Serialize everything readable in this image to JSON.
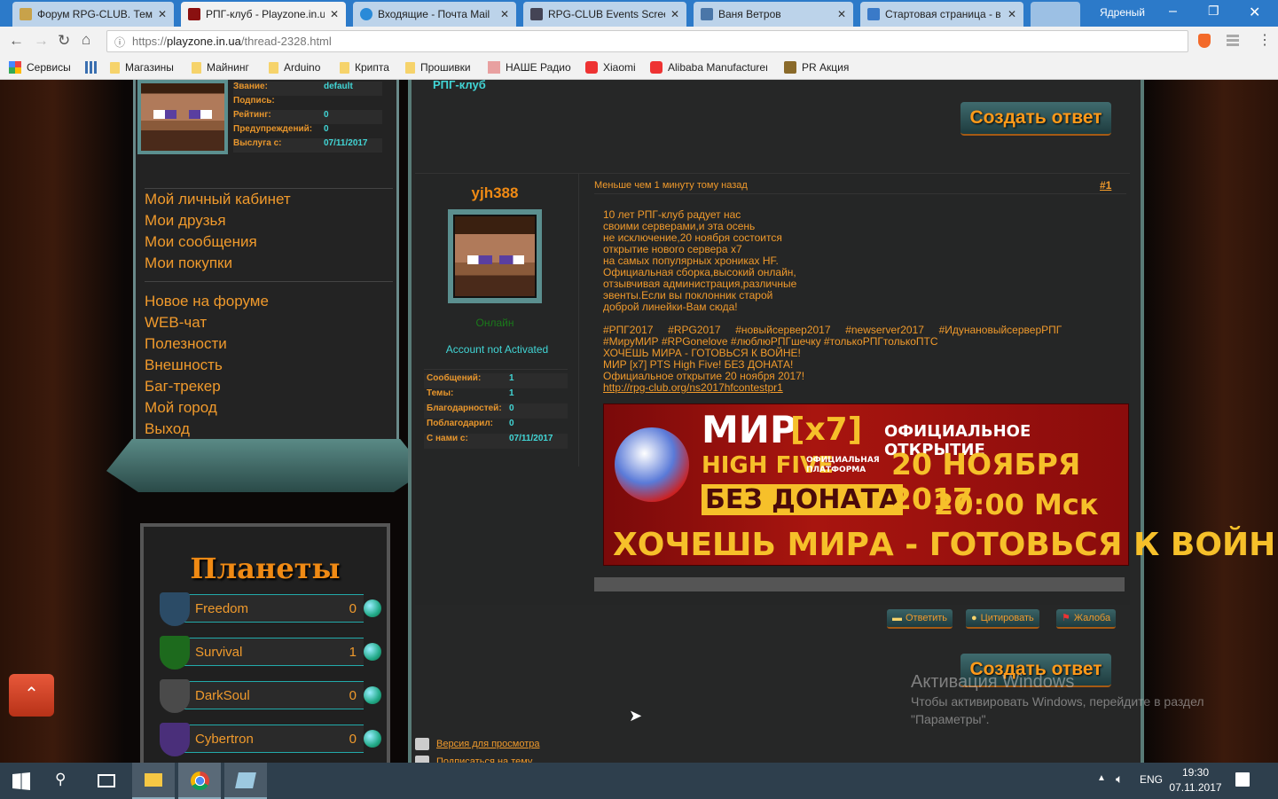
{
  "browser": {
    "tabs": [
      {
        "label": "Форум RPG-CLUB. Тема",
        "color": "#c8a24a"
      },
      {
        "label": "РПГ-клуб - Playzone.in.u",
        "color": "#8a1010",
        "active": true
      },
      {
        "label": "Входящие - Почта Mail",
        "color": "#2a8ad8"
      },
      {
        "label": "RPG-CLUB Events Screen",
        "color": "#445"
      },
      {
        "label": "Ваня Ветров",
        "color": "#4a76a8"
      },
      {
        "label": "Стартовая страница - в",
        "color": "#3a7ac8"
      }
    ],
    "profile_name": "Ядреный",
    "url_prefix": "https://",
    "url_host": "playzone.in.ua",
    "url_path": "/thread-2328.html",
    "bookmarks": [
      "Сервисы",
      "Магазины",
      "Майнинг",
      "Arduino",
      "Крипта",
      "Прошивки",
      "НАШЕ Радио",
      "Xiaomi",
      "Alibaba Manufacturer",
      "PR Акция"
    ]
  },
  "sidebar": {
    "stats": [
      {
        "label": "Звание:",
        "value": "default"
      },
      {
        "label": "Подпись:",
        "value": ""
      },
      {
        "label": "Рейтинг:",
        "value": "0"
      },
      {
        "label": "Предупреждений:",
        "value": "0"
      },
      {
        "label": "Выслуга с:",
        "value": "07/11/2017"
      }
    ],
    "menu1": [
      "Мой личный кабинет",
      "Мои друзья",
      "Мои сообщения",
      "Мои покупки"
    ],
    "menu2": [
      "Новое на форуме",
      "WEB-чат",
      "Полезности",
      "Внешность",
      "Баг-трекер",
      "Мой город",
      "Выход"
    ],
    "planets_title": "Планеты",
    "planets": [
      {
        "name": "Freedom",
        "count": "0",
        "color": "#2b4b66"
      },
      {
        "name": "Survival",
        "count": "1",
        "color": "#1d6a1d"
      },
      {
        "name": "DarkSoul",
        "count": "0",
        "color": "#4a4a4a"
      },
      {
        "name": "Cybertron",
        "count": "0",
        "color": "#4a2f7a"
      }
    ]
  },
  "main": {
    "forum_title": "РПГ-клуб",
    "create_reply": "Создать ответ",
    "post": {
      "author": "yjh388",
      "status": "Онлайн",
      "account": "Account not Activated",
      "stats": [
        {
          "label": "Сообщений:",
          "value": "1"
        },
        {
          "label": "Темы:",
          "value": "1"
        },
        {
          "label": "Благодарностей:",
          "value": "0"
        },
        {
          "label": "Поблагодарил:",
          "value": "0"
        },
        {
          "label": "С нами с:",
          "value": "07/11/2017"
        }
      ],
      "time": "Меньше чем 1 минуту тому назад",
      "number": "#1",
      "lines": [
        "10 лет РПГ-клуб радует нас",
        "своими серверами,и эта осень",
        "не исключение,20 ноября состоится",
        "открытие нового сервера x7",
        "на самых популярных хрониках HF.",
        "Официальная сборка,высокий онлайн,",
        "отзывчивая администрация,различные",
        "эвенты.Если вы поклонник старой",
        "доброй линейки-Вам сюда!"
      ],
      "hashtags1": "#РПГ2017     #RPG2017     #новыйсервер2017     #newserver2017     #ИдунановыйсерверРПГ",
      "lines2": [
        "#МируМИР #RPGonelove #люблюРПГшечку #толькоРПГтолькоПТС",
        "ХОЧЕШЬ МИРА - ГОТОВЬСЯ К ВОЙНЕ!",
        "МИР [x7] PTS High Five! БЕЗ ДОНАТА!",
        "Официальное открытие 20 ноября 2017!"
      ],
      "link": "http://rpg-club.org/ns2017hfcontestpr1",
      "banner": {
        "mir": "МИР",
        "x7": "[x7]",
        "hf": "HIGH FIVE",
        "platform": "ОФИЦИАЛЬНАЯ ПЛАТФОРМА",
        "nodonate": "БЕЗ ДОНАТА",
        "open": "ОФИЦИАЛЬНОЕ ОТКРЫТИЕ",
        "date": "20 НОЯБРЯ 2017",
        "time": "20:00 Мск",
        "slogan": "ХОЧЕШЬ МИРА - ГОТОВЬСЯ К ВОЙНЕ"
      },
      "actions": [
        "Ответить",
        "Цитировать",
        "Жалоба"
      ]
    },
    "footer_links": [
      "Версия для просмотра",
      "Подписаться на тему"
    ]
  },
  "watermark": {
    "title": "Активация Windows",
    "text": "Чтобы активировать Windows, перейдите в раздел \"Параметры\"."
  },
  "taskbar": {
    "lang": "ENG",
    "time": "19:30",
    "date": "07.11.2017"
  }
}
